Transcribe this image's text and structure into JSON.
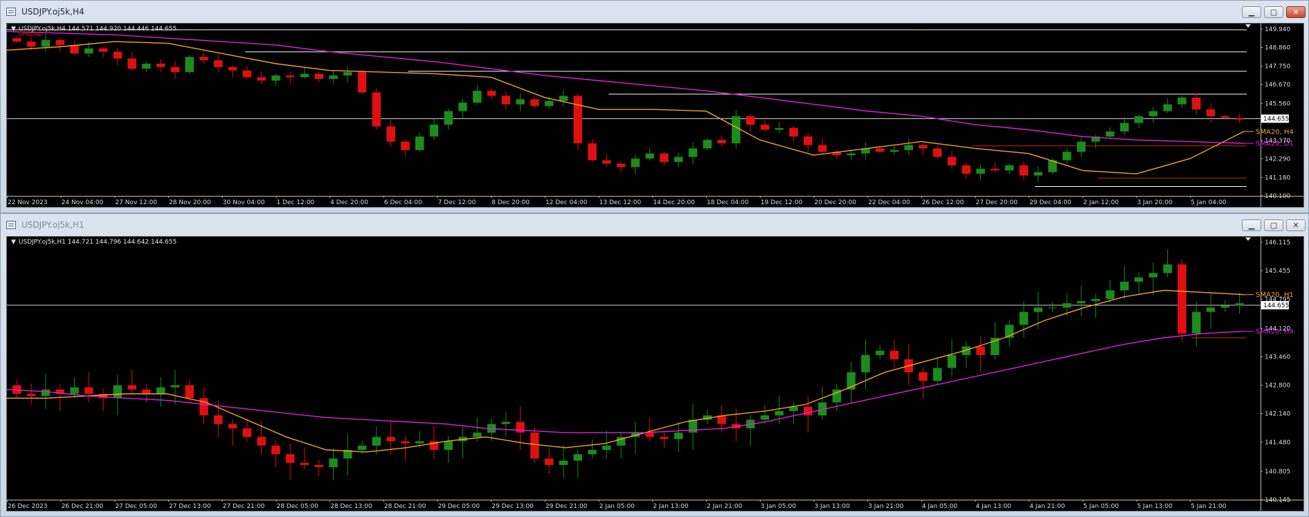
{
  "windows": [
    {
      "title": "USDJPY.oj5k,H4",
      "active": true,
      "header": "USDJPY.oj5k,H4  144.571 144.920 144.446 144.655",
      "subheader": "SPREAD",
      "current_price": "144.655",
      "price_labels": [
        "149.940",
        "148.860",
        "147.750",
        "146.670",
        "145.560",
        "144.655",
        "143.370",
        "142.290",
        "141.180",
        "140.100"
      ],
      "date_labels": [
        "22 Nov 2023",
        "24 Nov 04:00",
        "27 Nov 12:00",
        "28 Nov 20:00",
        "30 Nov 04:00",
        "1 Dec 12:00",
        "4 Dec 20:00",
        "6 Dec 04:00",
        "7 Dec 12:00",
        "8 Dec 20:00",
        "12 Dec 04:00",
        "13 Dec 12:00",
        "14 Dec 20:00",
        "18 Dec 04:00",
        "19 Dec 12:00",
        "20 Dec 20:00",
        "22 Dec 04:00",
        "26 Dec 12:00",
        "27 Dec 20:00",
        "29 Dec 04:00",
        "2 Jan 12:00",
        "3 Jan 20:00",
        "5 Jan 04:00"
      ],
      "ma_labels": [
        {
          "text": "SMA20, H4",
          "color": "#f5a623"
        },
        {
          "text": "SMA20, D1",
          "color": "#e020e0"
        }
      ],
      "chart_data": {
        "type": "line",
        "price_range": [
          140.1,
          149.94
        ],
        "series": [
          {
            "name": "SMA20, H4",
            "color": "#f5a623",
            "values": [
              148.7,
              148.9,
              149.2,
              149.1,
              148.5,
              147.9,
              147.5,
              147.4,
              147.3,
              147.1,
              145.9,
              145.2,
              145.2,
              145.1,
              143.4,
              142.5,
              142.9,
              143.3,
              142.9,
              142.6,
              141.6,
              141.4,
              142.3,
              143.9
            ]
          },
          {
            "name": "SMA20, D1",
            "color": "#e020e0",
            "values": [
              149.8,
              149.7,
              149.6,
              149.4,
              149.2,
              149.0,
              148.6,
              148.3,
              148.0,
              147.6,
              147.2,
              146.9,
              146.6,
              146.3,
              145.9,
              145.5,
              145.1,
              144.8,
              144.3,
              144.0,
              143.6,
              143.4,
              143.3,
              143.2
            ]
          }
        ],
        "levels": [
          {
            "price": 149.9,
            "color": "#ffffff",
            "x0": 0.0
          },
          {
            "price": 148.6,
            "color": "#ffffff",
            "x0": 0.19
          },
          {
            "price": 147.45,
            "color": "#ffffff",
            "x0": 0.32
          },
          {
            "price": 146.1,
            "color": "#ffffff",
            "x0": 0.48
          },
          {
            "price": 143.05,
            "color": "#d42020",
            "x0": 0.77
          },
          {
            "price": 141.15,
            "color": "#d42020",
            "x0": 0.87
          },
          {
            "price": 140.65,
            "color": "#ffffff",
            "x0": 0.82
          }
        ],
        "candle_closes": [
          149.2,
          148.9,
          149.3,
          149.0,
          148.5,
          148.8,
          148.6,
          148.2,
          147.6,
          147.9,
          147.7,
          147.4,
          148.3,
          148.1,
          147.7,
          147.5,
          147.1,
          146.9,
          147.2,
          147.1,
          147.3,
          147.0,
          147.2,
          147.4,
          146.2,
          144.2,
          143.3,
          142.8,
          143.6,
          144.3,
          145.1,
          145.6,
          146.3,
          146.0,
          145.5,
          145.8,
          145.4,
          145.7,
          146.0,
          143.2,
          142.2,
          142.0,
          141.8,
          142.3,
          142.6,
          142.1,
          142.4,
          142.9,
          143.4,
          143.2,
          144.8,
          144.3,
          144.0,
          144.1,
          143.6,
          143.1,
          142.7,
          142.5,
          142.6,
          142.9,
          142.7,
          142.8,
          143.1,
          142.9,
          142.4,
          141.9,
          141.4,
          141.7,
          141.6,
          141.9,
          141.3,
          141.5,
          142.2,
          142.7,
          143.3,
          143.6,
          143.9,
          144.4,
          144.8,
          145.1,
          145.5,
          145.9,
          145.2,
          144.8,
          144.7,
          144.6
        ]
      }
    },
    {
      "title": "USDJPY.oj5k,H1",
      "active": false,
      "header": "USDJPY.oj5k,H1  144.721 144.796 144.642 144.655",
      "subheader": "",
      "current_price": "144.655",
      "price_labels": [
        "146.115",
        "145.455",
        "144.795",
        "144.655",
        "144.120",
        "143.460",
        "142.800",
        "142.140",
        "141.480",
        "140.805",
        "140.145"
      ],
      "date_labels": [
        "26 Dec 2023",
        "26 Dec 21:00",
        "27 Dec 05:00",
        "27 Dec 13:00",
        "27 Dec 21:00",
        "28 Dec 05:00",
        "28 Dec 13:00",
        "28 Dec 21:00",
        "29 Dec 05:00",
        "29 Dec 13:00",
        "29 Dec 21:00",
        "2 Jan 05:00",
        "2 Jan 13:00",
        "2 Jan 21:00",
        "3 Jan 05:00",
        "3 Jan 13:00",
        "3 Jan 21:00",
        "4 Jan 05:00",
        "4 Jan 13:00",
        "4 Jan 21:00",
        "5 Jan 05:00",
        "5 Jan 13:00",
        "5 Jan 21:00"
      ],
      "ma_labels": [
        {
          "text": "SMA20, H1",
          "color": "#f5a623"
        },
        {
          "text": "SMA20, H4",
          "color": "#e020e0"
        }
      ],
      "chart_data": {
        "type": "line",
        "price_range": [
          140.145,
          146.115
        ],
        "series": [
          {
            "name": "SMA20, H1",
            "color": "#f5a623",
            "values": [
              142.5,
              142.5,
              142.55,
              142.6,
              142.6,
              142.4,
              142.0,
              141.6,
              141.3,
              141.25,
              141.35,
              141.5,
              141.6,
              141.45,
              141.35,
              141.45,
              141.7,
              141.95,
              142.1,
              142.2,
              142.35,
              142.7,
              143.1,
              143.35,
              143.6,
              143.9,
              144.3,
              144.6,
              144.85,
              145.0,
              144.95,
              144.9
            ]
          },
          {
            "name": "SMA20, H4",
            "color": "#e020e0",
            "values": [
              142.7,
              142.65,
              142.55,
              142.5,
              142.45,
              142.35,
              142.25,
              142.15,
              142.05,
              142.0,
              141.95,
              141.9,
              141.8,
              141.75,
              141.7,
              141.7,
              141.7,
              141.75,
              141.8,
              141.95,
              142.15,
              142.35,
              142.55,
              142.75,
              142.95,
              143.15,
              143.35,
              143.55,
              143.75,
              143.9,
              144.0,
              144.05
            ]
          }
        ],
        "levels": [
          {
            "price": 143.9,
            "color": "#d42020",
            "x0": 0.945
          }
        ],
        "candle_closes": [
          142.6,
          142.55,
          142.7,
          142.6,
          142.75,
          142.6,
          142.5,
          142.8,
          142.7,
          142.6,
          142.75,
          142.8,
          142.5,
          142.1,
          141.9,
          141.8,
          141.6,
          141.4,
          141.2,
          141.0,
          140.95,
          140.9,
          141.1,
          141.3,
          141.4,
          141.6,
          141.5,
          141.45,
          141.5,
          141.3,
          141.5,
          141.6,
          141.7,
          141.9,
          141.95,
          141.7,
          141.1,
          140.95,
          141.05,
          141.2,
          141.3,
          141.4,
          141.6,
          141.7,
          141.6,
          141.55,
          141.7,
          142.0,
          142.1,
          141.9,
          141.8,
          142.0,
          142.1,
          142.2,
          142.3,
          142.1,
          142.4,
          142.7,
          143.1,
          143.5,
          143.6,
          143.4,
          143.1,
          142.9,
          143.2,
          143.5,
          143.7,
          143.5,
          143.9,
          144.2,
          144.5,
          144.6,
          144.6,
          144.7,
          144.75,
          144.8,
          145.0,
          145.2,
          145.3,
          145.4,
          145.6,
          144.0,
          144.5,
          144.6,
          144.65,
          144.7
        ]
      }
    }
  ]
}
